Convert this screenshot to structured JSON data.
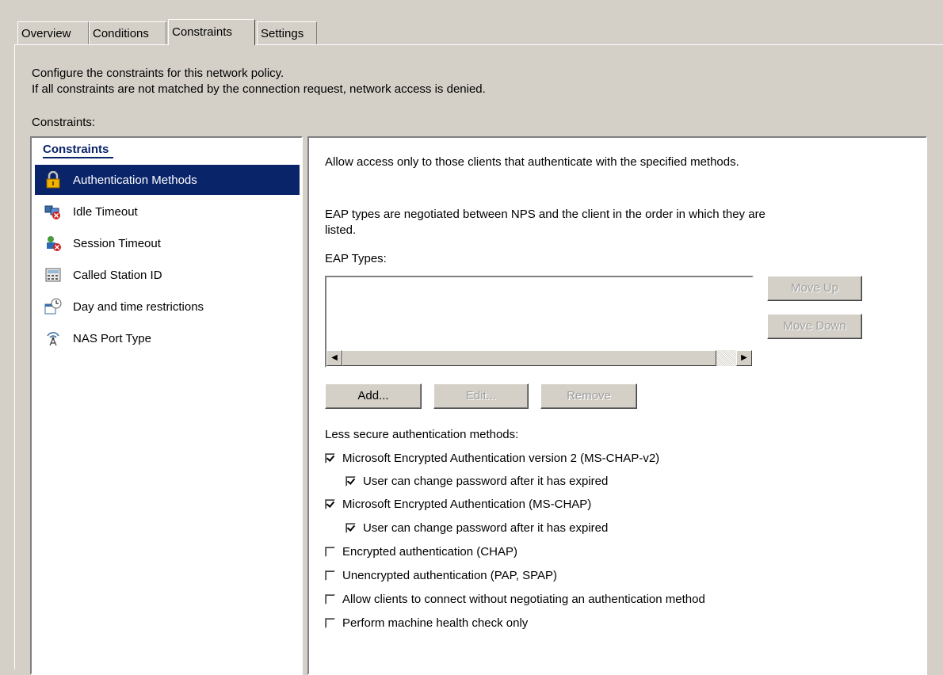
{
  "tabs": [
    "Overview",
    "Conditions",
    "Constraints",
    "Settings"
  ],
  "active_tab": "Constraints",
  "description": {
    "line1": "Configure the constraints for this network policy.",
    "line2": "If all constraints are not matched by the connection request, network access is denied."
  },
  "constraints_label": "Constraints:",
  "list": {
    "header": "Constraints",
    "items": [
      {
        "label": "Authentication Methods",
        "icon": "lock-icon",
        "selected": true
      },
      {
        "label": "Idle Timeout",
        "icon": "idle-timeout-icon",
        "selected": false
      },
      {
        "label": "Session Timeout",
        "icon": "session-timeout-icon",
        "selected": false
      },
      {
        "label": "Called Station ID",
        "icon": "called-station-icon",
        "selected": false
      },
      {
        "label": "Day and time restrictions",
        "icon": "calendar-clock-icon",
        "selected": false
      },
      {
        "label": "NAS Port Type",
        "icon": "antenna-icon",
        "selected": false
      }
    ]
  },
  "right": {
    "intro": "Allow access only to those clients that authenticate with the specified methods.",
    "eap_note_line1": "EAP types are negotiated between NPS and the client in the order in which they are",
    "eap_note_line2": "listed.",
    "eap_types_label": "EAP Types:",
    "eap_types": [],
    "buttons": {
      "move_up": "Move Up",
      "move_down": "Move Down",
      "add": "Add...",
      "edit": "Edit...",
      "remove": "Remove"
    },
    "less_secure_label": "Less secure authentication methods:",
    "options": [
      {
        "label": "Microsoft Encrypted Authentication version 2 (MS-CHAP-v2)",
        "checked": true,
        "indent": false
      },
      {
        "label": "User can change password after it has expired",
        "checked": true,
        "indent": true
      },
      {
        "label": "Microsoft Encrypted Authentication (MS-CHAP)",
        "checked": true,
        "indent": false
      },
      {
        "label": "User can change password after it has expired",
        "checked": true,
        "indent": true
      },
      {
        "label": "Encrypted authentication (CHAP)",
        "checked": false,
        "indent": false
      },
      {
        "label": "Unencrypted authentication (PAP, SPAP)",
        "checked": false,
        "indent": false
      },
      {
        "label": "Allow clients to connect without negotiating an authentication method",
        "checked": false,
        "indent": false
      },
      {
        "label": "Perform machine health check only",
        "checked": false,
        "indent": false
      }
    ]
  },
  "colors": {
    "selection": "#0a246a",
    "face": "#d4d0c8"
  }
}
